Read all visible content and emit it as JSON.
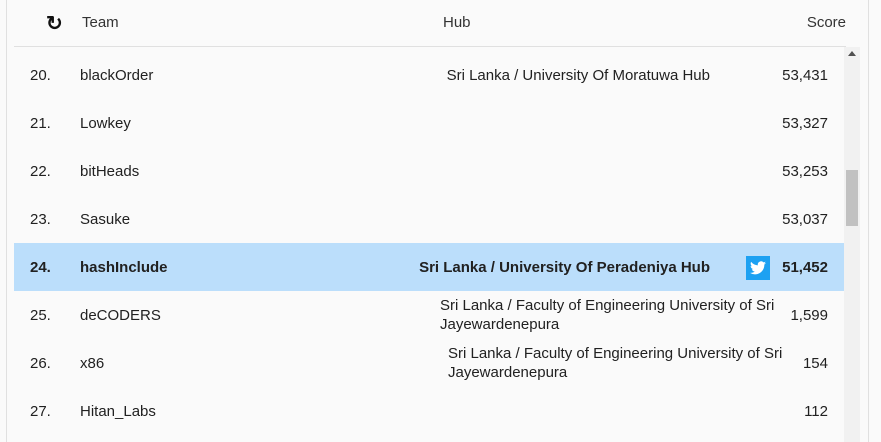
{
  "header": {
    "refresh_icon": "refresh-icon",
    "team": "Team",
    "hub": "Hub",
    "score": "Score"
  },
  "rows": [
    {
      "rank": "20.",
      "team": "blackOrder",
      "hub": "Sri Lanka / University Of Moratuwa Hub",
      "score": "53,431"
    },
    {
      "rank": "21.",
      "team": "Lowkey",
      "hub": "",
      "score": "53,327"
    },
    {
      "rank": "22.",
      "team": "bitHeads",
      "hub": "",
      "score": "53,253"
    },
    {
      "rank": "23.",
      "team": "Sasuke",
      "hub": "",
      "score": "53,037"
    },
    {
      "rank": "24.",
      "team": "hashInclude",
      "hub": "Sri Lanka / University Of Peradeniya Hub",
      "score": "51,452",
      "highlight": true,
      "twitter": true
    },
    {
      "rank": "25.",
      "team": "deCODERS",
      "hub": "Sri Lanka / Faculty of Engineering University of Sri Jayewardenepura",
      "score": "1,599",
      "wrap": true
    },
    {
      "rank": "26.",
      "team": "x86",
      "hub": "Sri Lanka / Faculty of Engineering University of Sri Jayewardenepura",
      "score": "154",
      "wrap": true
    },
    {
      "rank": "27.",
      "team": "Hitan_Labs",
      "hub": "",
      "score": "112"
    }
  ],
  "colors": {
    "highlight": "#bbdefb",
    "twitter": "#1da1f2"
  }
}
